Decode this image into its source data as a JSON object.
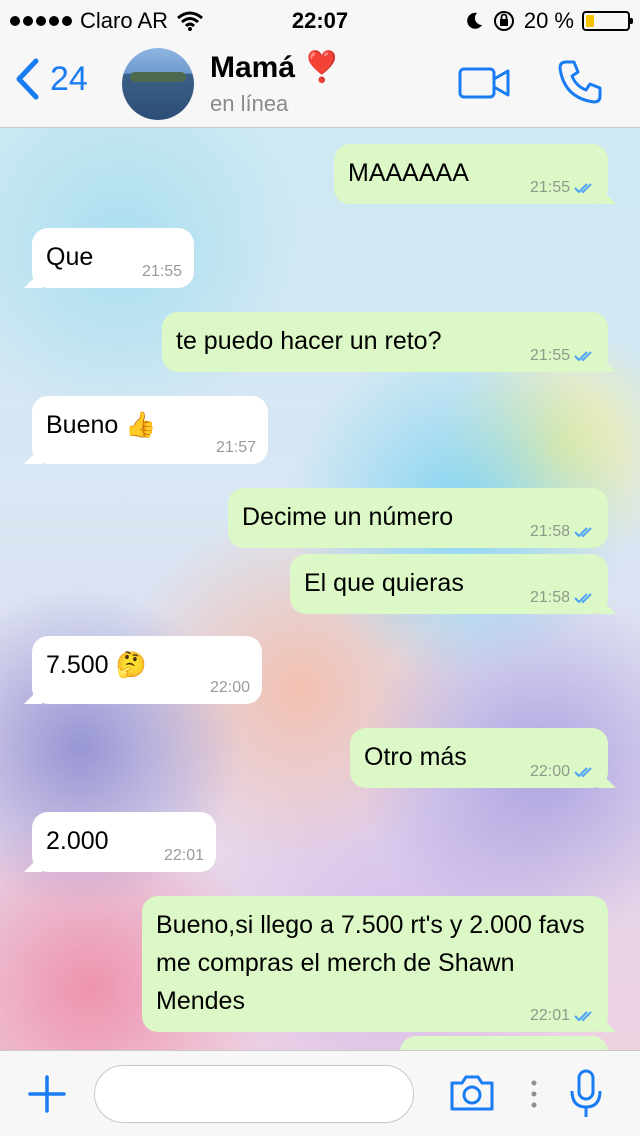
{
  "status_bar": {
    "carrier": "Claro AR",
    "time": "22:07",
    "battery": "20 %"
  },
  "header": {
    "back_count": "24",
    "contact_name": "Mamá ❣️",
    "contact_status": "en línea"
  },
  "messages": [
    {
      "dir": "out",
      "text": "MAAAAAA",
      "time": "21:55"
    },
    {
      "dir": "in",
      "text": "Que",
      "time": "21:55"
    },
    {
      "dir": "out",
      "text": "te puedo hacer un reto?",
      "time": "21:55"
    },
    {
      "dir": "in",
      "text": "Bueno 👍",
      "time": "21:57"
    },
    {
      "dir": "out",
      "text": "Decime un número",
      "time": "21:58"
    },
    {
      "dir": "out",
      "text": "El que quieras",
      "time": "21:58"
    },
    {
      "dir": "in",
      "text": "7.500 🤔",
      "time": "22:00"
    },
    {
      "dir": "out",
      "text": "Otro más",
      "time": "22:00"
    },
    {
      "dir": "in",
      "text": "2.000",
      "time": "22:01"
    },
    {
      "dir": "out",
      "text": "Bueno,si llego a 7.500 rt's y 2.000 favs me compras el merch de Shawn Mendes",
      "time": "22:01"
    }
  ],
  "input": {
    "placeholder": ""
  },
  "colors": {
    "accent": "#1a7cf3",
    "bubble_out": "#dcf8c6",
    "bubble_in": "#ffffff",
    "read_ticks": "#4fa3f7"
  },
  "icons": [
    "signal-dots-icon",
    "wifi-icon",
    "moon-icon",
    "rotation-lock-icon",
    "battery-icon",
    "back-chevron-icon",
    "video-call-icon",
    "phone-icon",
    "double-check-icon",
    "plus-icon",
    "camera-icon",
    "more-dots-icon",
    "microphone-icon"
  ]
}
